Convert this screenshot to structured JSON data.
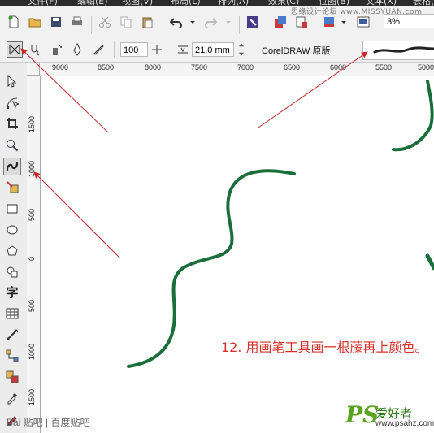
{
  "menubar": {
    "items": [
      "文件(F)",
      "编辑(E)",
      "视图(V)",
      "布局(L)",
      "排列(A)",
      "效果(C)",
      "位图(B)",
      "文本(X)",
      "表格(T)"
    ]
  },
  "watermark_top": "思缘设计论坛 www.MISSYUAN.com",
  "toolbar": {
    "zoom_value": "3%"
  },
  "propbar": {
    "smoothing_value": "100",
    "width_value": "21.0 mm",
    "preset_label": "CorelDRAW 原版"
  },
  "ruler": {
    "horizontal_ticks": [
      "9000",
      "8500",
      "8000",
      "7500",
      "7000",
      "6500",
      "6000",
      "5500",
      "5000"
    ],
    "vertical_ticks": [
      "1500",
      "1000",
      "500",
      "0",
      "500",
      "1000",
      "1500"
    ]
  },
  "toolbox": {
    "text_tool_glyph": "字"
  },
  "caption": "12. 用画笔工具画一根藤再上颜色。",
  "watermark_bottom": {
    "baidu": "Bai 贴吧 | 百度贴吧",
    "ps_logo": "PS",
    "site_name": "爱好者",
    "site_url": "www.psahz.com"
  },
  "colors": {
    "vine": "#1a6e3a",
    "arrow": "#c8282a",
    "caption": "#d6322a"
  }
}
